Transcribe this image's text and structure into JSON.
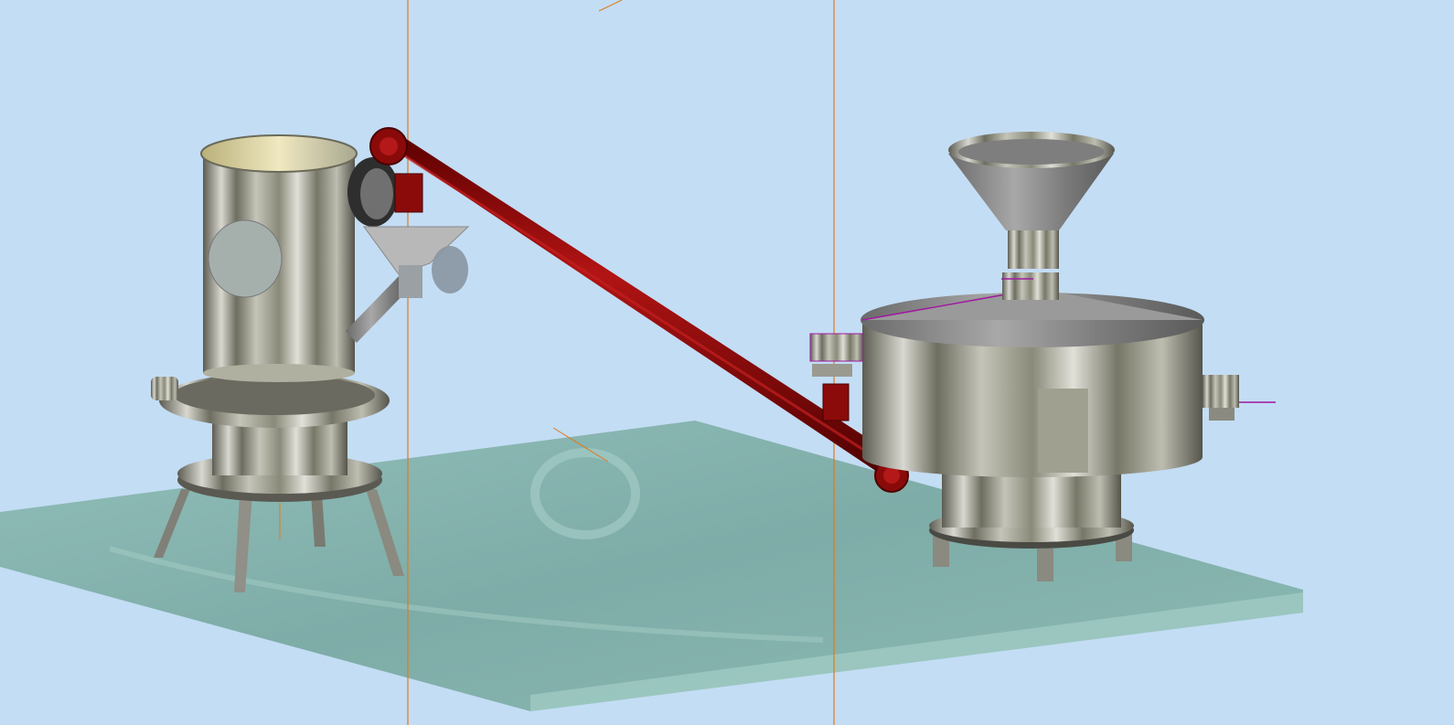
{
  "scene": {
    "background_color": "#c3ddf4",
    "floor_color": "#7aa9a3",
    "conveyor_color": "#8b0b0b",
    "steel_color": "#8f8f8f",
    "guide_line_color": "#e07a1a",
    "wire_color": "#a01aa0",
    "objects": [
      "cyclone-separator",
      "screw-conveyor",
      "feed-hopper",
      "vibrating-sieve",
      "glass-floor-plate"
    ]
  }
}
